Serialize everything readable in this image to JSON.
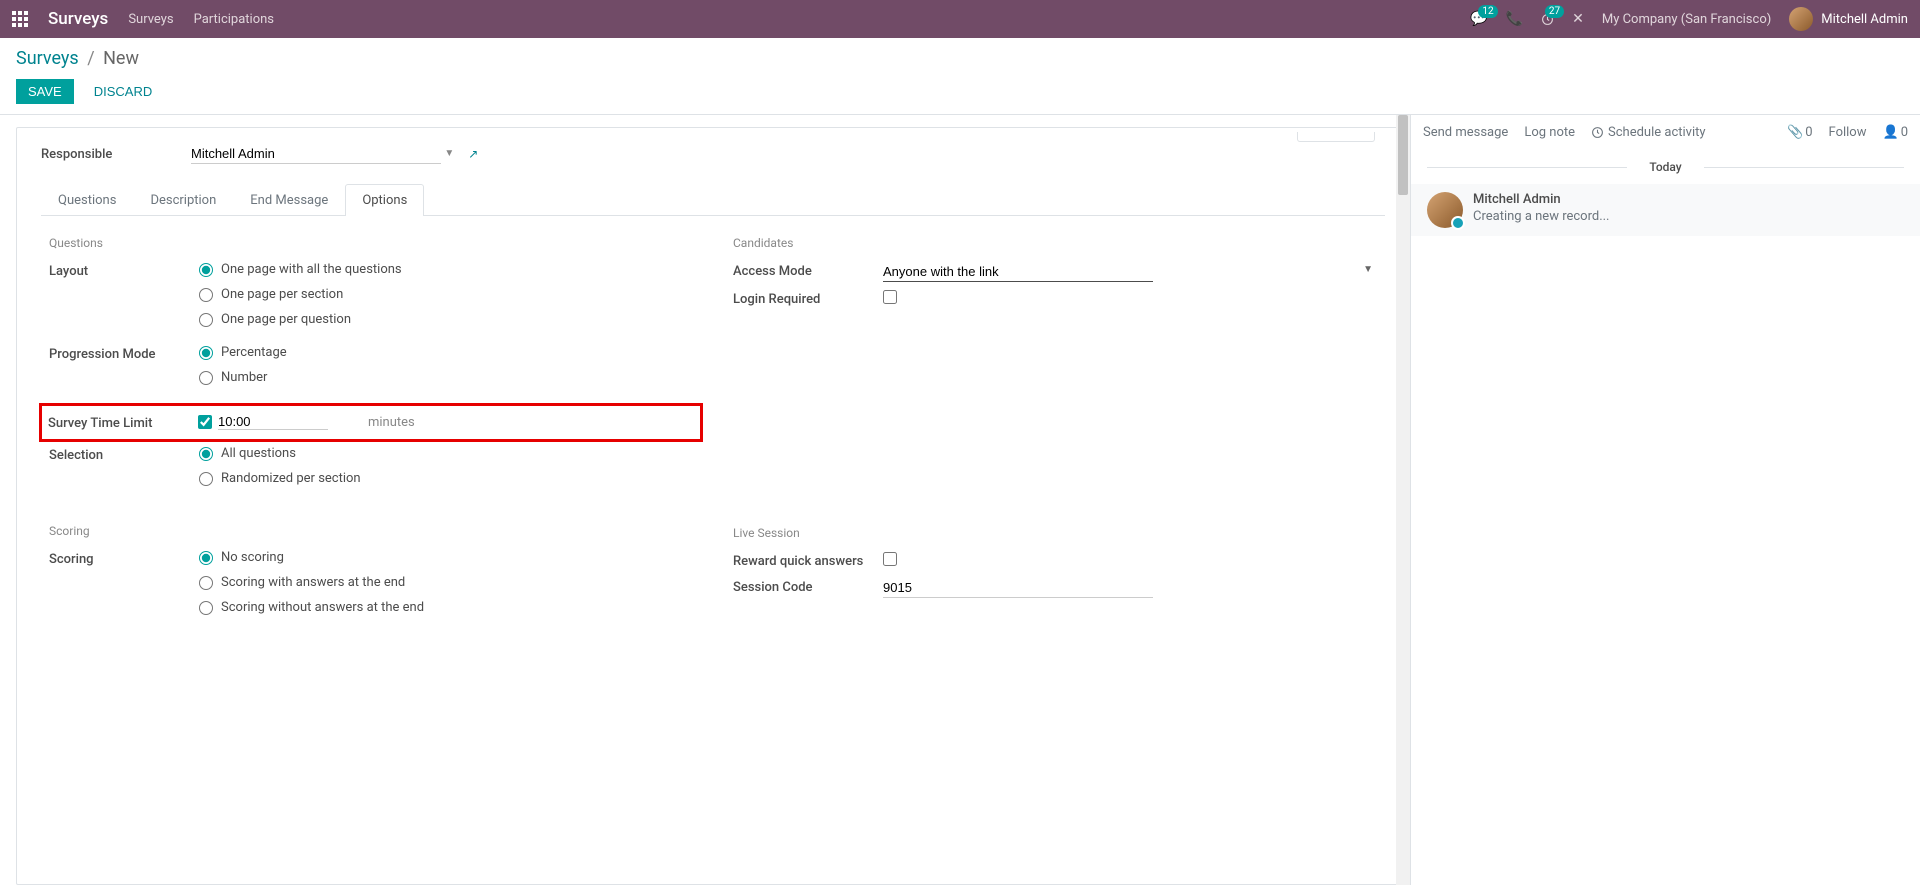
{
  "navbar": {
    "brand": "Surveys",
    "menu": [
      "Surveys",
      "Participations"
    ],
    "messages_count": "12",
    "activities_count": "27",
    "company": "My Company (San Francisco)",
    "user": "Mitchell Admin"
  },
  "breadcrumb": {
    "root": "Surveys",
    "current": "New"
  },
  "actions": {
    "save": "SAVE",
    "discard": "DISCARD"
  },
  "form": {
    "responsible_label": "Responsible",
    "responsible_value": "Mitchell Admin",
    "tabs": [
      "Questions",
      "Description",
      "End Message",
      "Options"
    ],
    "active_tab": 3,
    "sections": {
      "questions": {
        "title": "Questions",
        "layout_label": "Layout",
        "layout_options": [
          "One page with all the questions",
          "One page per section",
          "One page per question"
        ],
        "layout_selected": 0,
        "progression_label": "Progression Mode",
        "progression_options": [
          "Percentage",
          "Number"
        ],
        "progression_selected": 0,
        "time_limit_label": "Survey Time Limit",
        "time_limit_checked": true,
        "time_limit_value": "10:00",
        "time_limit_unit": "minutes",
        "selection_label": "Selection",
        "selection_options": [
          "All questions",
          "Randomized per section"
        ],
        "selection_selected": 0
      },
      "candidates": {
        "title": "Candidates",
        "access_mode_label": "Access Mode",
        "access_mode_value": "Anyone with the link",
        "login_required_label": "Login Required",
        "login_required_checked": false
      },
      "scoring": {
        "title": "Scoring",
        "scoring_label": "Scoring",
        "scoring_options": [
          "No scoring",
          "Scoring with answers at the end",
          "Scoring without answers at the end"
        ],
        "scoring_selected": 0
      },
      "live_session": {
        "title": "Live Session",
        "reward_label": "Reward quick answers",
        "reward_checked": false,
        "session_code_label": "Session Code",
        "session_code_value": "9015"
      }
    }
  },
  "chatter": {
    "send_message": "Send message",
    "log_note": "Log note",
    "schedule_activity": "Schedule activity",
    "attachments_count": "0",
    "follow_label": "Follow",
    "followers_count": "0",
    "separator": "Today",
    "message": {
      "author": "Mitchell Admin",
      "body": "Creating a new record..."
    }
  }
}
